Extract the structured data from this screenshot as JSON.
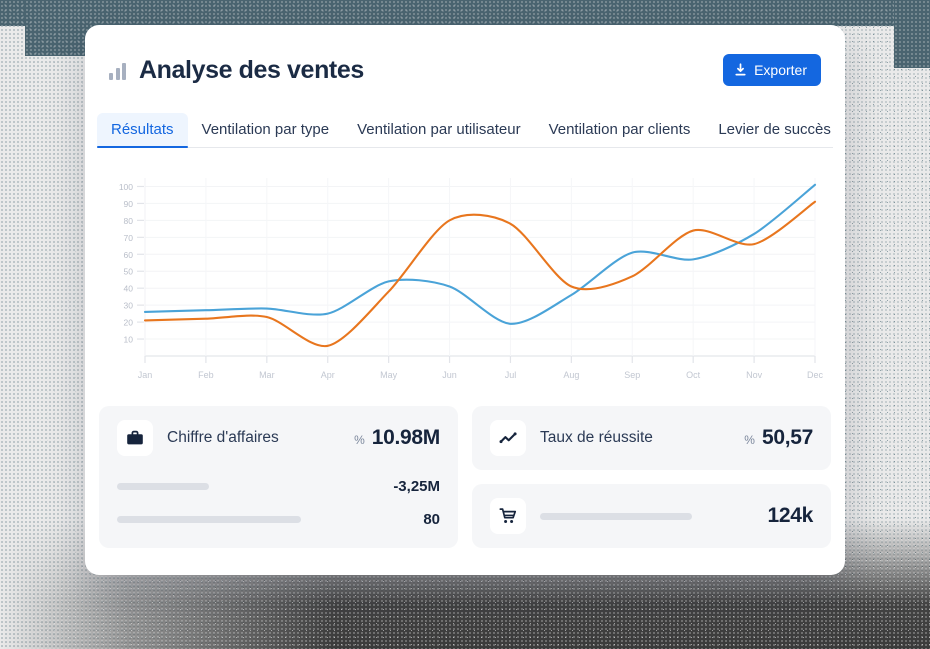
{
  "header": {
    "icon": "bar-chart-icon",
    "title": "Analyse des ventes",
    "export_label": "Exporter",
    "export_icon": "download-icon",
    "accent_color": "#1467e0"
  },
  "tabs": [
    {
      "label": "Résultats",
      "active": true
    },
    {
      "label": "Ventilation par type",
      "active": false
    },
    {
      "label": "Ventilation par utilisateur",
      "active": false
    },
    {
      "label": "Ventilation par clients",
      "active": false
    },
    {
      "label": "Levier de succès",
      "active": false
    }
  ],
  "chart_data": {
    "type": "line",
    "title": "",
    "xlabel": "",
    "ylabel": "",
    "categories": [
      "Jan",
      "Feb",
      "Mar",
      "Apr",
      "May",
      "Jun",
      "Jul",
      "Aug",
      "Sep",
      "Oct",
      "Nov",
      "Dec"
    ],
    "yticks": [
      10,
      20,
      30,
      40,
      50,
      60,
      70,
      80,
      90,
      100
    ],
    "ylim": [
      0,
      105
    ],
    "grid": true,
    "legend": "none",
    "series": [
      {
        "name": "series-blue",
        "color": "#4aa3d8",
        "values": [
          26,
          27,
          28,
          25,
          44,
          41,
          19,
          36,
          61,
          57,
          72,
          101,
          102
        ]
      },
      {
        "name": "series-orange",
        "color": "#e8761e",
        "values": [
          21,
          22,
          23,
          6,
          38,
          80,
          78,
          41,
          47,
          74,
          66,
          91,
          92
        ]
      }
    ]
  },
  "kpis": {
    "revenue": {
      "icon": "briefcase-icon",
      "label": "Chiffre d'affaires",
      "unit": "%",
      "value": "10.98M"
    },
    "success_rate": {
      "icon": "trend-line-icon",
      "label": "Taux de réussite",
      "unit": "%",
      "value": "50,57"
    },
    "skeleton_rows": [
      {
        "value": "-3,25M"
      },
      {
        "value": "80"
      }
    ],
    "cart": {
      "icon": "shopping-cart-icon",
      "value": "124k"
    }
  }
}
